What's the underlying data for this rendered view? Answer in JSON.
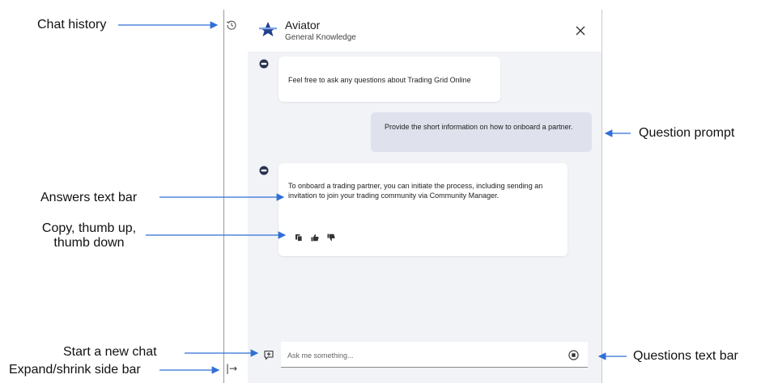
{
  "app": {
    "title": "Aviator",
    "subtitle": "General Knowledge",
    "logo_icon": "aviator-logo-icon",
    "accent_color": "#1f3f8f",
    "close_icon": "close-icon"
  },
  "sidebar": {
    "history_icon": "history-icon",
    "expand_label": "|→"
  },
  "messages": [
    {
      "role": "assistant",
      "text": "Feel free to ask any questions about Trading Grid Online"
    },
    {
      "role": "user",
      "text": "Provide the short information on how to onboard a partner."
    },
    {
      "role": "assistant",
      "text": "To onboard a trading partner, you can initiate the process, including sending an invitation to join your trading community via Community Manager.",
      "actions": [
        "copy-icon",
        "thumb-up-icon",
        "thumb-down-icon"
      ]
    }
  ],
  "composer": {
    "placeholder": "Ask me something...",
    "new_chat_icon": "new-chat-icon",
    "stop_icon": "stop-icon"
  },
  "annotations": {
    "chat_history": "Chat history",
    "question_prompt": "Question prompt",
    "answers_text_bar": "Answers text bar",
    "copy_thumbs_line1": "Copy, thumb up,",
    "copy_thumbs_line2": "thumb down",
    "start_new_chat": "Start a new chat",
    "expand_shrink": "Expand/shrink side bar",
    "questions_text_bar": "Questions text bar",
    "arrow_color": "#2f6fd6"
  }
}
